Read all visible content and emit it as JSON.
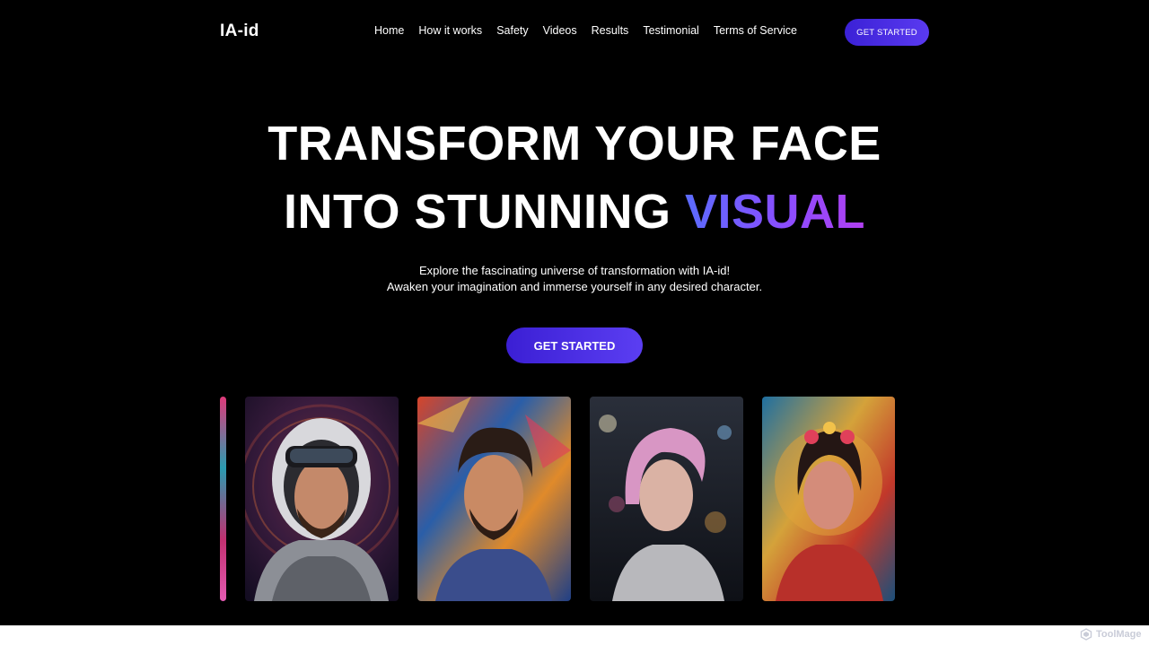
{
  "header": {
    "logo": "IA-id",
    "nav": [
      "Home",
      "How it works",
      "Safety",
      "Videos",
      "Results",
      "Testimonial",
      "Terms of Service"
    ],
    "cta": "GET STARTED"
  },
  "hero": {
    "line1": "TRANSFORM YOUR FACE",
    "line2_prefix": "INTO STUNNING ",
    "line2_accent": "VISUAL",
    "subtitle_1": "Explore the fascinating universe of transformation with IA-id!",
    "subtitle_2": "Awaken your imagination and immerse yourself in any desired character.",
    "cta": "GET STARTED"
  },
  "gallery": {
    "cards": [
      "partial-portrait",
      "astronaut-portrait",
      "painted-man-portrait",
      "pink-hair-woman-portrait",
      "floral-woman-portrait"
    ]
  },
  "watermark": "ToolMage",
  "colors": {
    "background": "#000000",
    "accent_start": "#5b6cff",
    "accent_end": "#b13ff0",
    "button": "#4a2fe8"
  }
}
